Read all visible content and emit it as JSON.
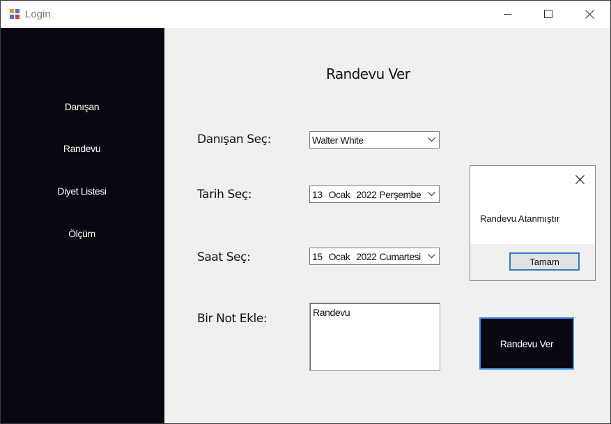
{
  "window": {
    "title": "Login"
  },
  "sidebar": {
    "items": [
      {
        "label": "Danışan"
      },
      {
        "label": "Randevu"
      },
      {
        "label": "Diyet Listesi"
      },
      {
        "label": "Ölçüm"
      }
    ]
  },
  "main": {
    "title": "Randevu Ver",
    "labels": {
      "client": "Danışan Seç:",
      "date": "Tarih Seç:",
      "time": "Saat Seç:",
      "note": "Bir Not Ekle:"
    },
    "client_select": {
      "value": "Walter White"
    },
    "date_picker": {
      "day": "13",
      "month": "Ocak",
      "year": "2022",
      "weekday": "Perşembe"
    },
    "time_picker": {
      "day": "15",
      "month": "Ocak",
      "year": "2022",
      "weekday": "Cumartesi"
    },
    "note_input": {
      "value": "Randevu"
    },
    "submit_button": {
      "label": "Randevu Ver"
    }
  },
  "message_box": {
    "text": "Randevu Atanmıştır",
    "ok_label": "Tamam"
  },
  "colors": {
    "sidebar_bg": "#0a0711",
    "accent_border": "#3c8ee8",
    "window_bg": "#f0f0f0"
  },
  "icons": {
    "app": "windows-forms-app-icon",
    "minimize": "minimize-icon",
    "maximize": "maximize-icon",
    "close": "close-icon",
    "dropdown": "chevron-down-icon"
  }
}
